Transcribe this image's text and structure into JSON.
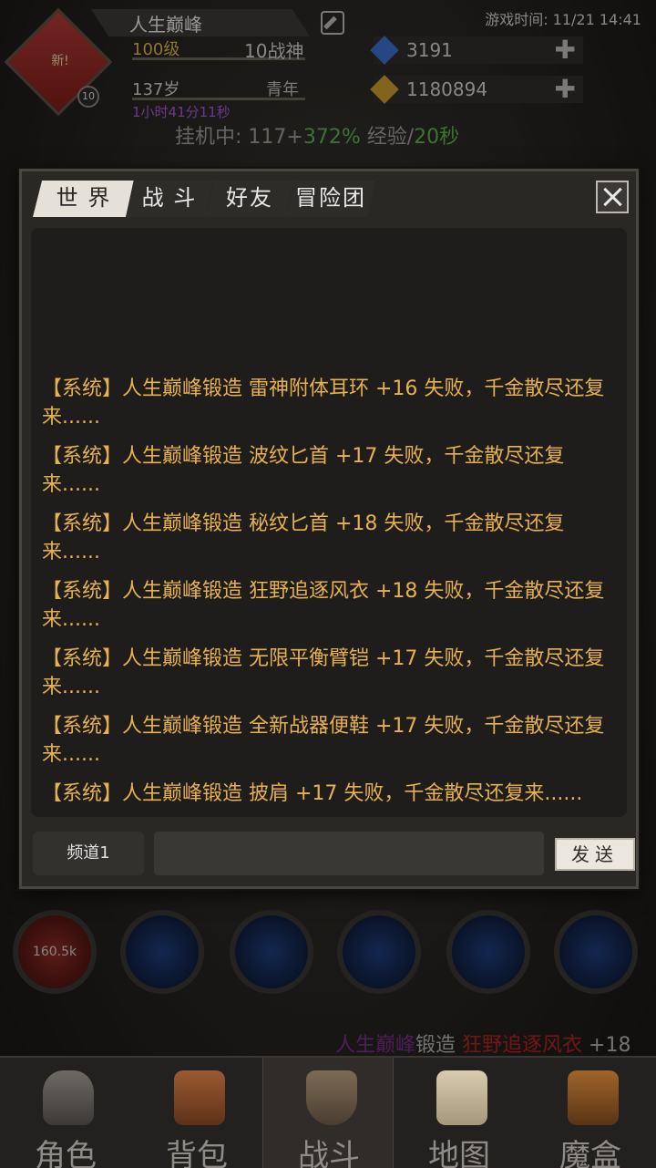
{
  "status": {
    "game_time": "游戏时间: 11/21 14:41"
  },
  "player": {
    "name": "人生巅峰",
    "avatar_badge": "新!",
    "badge_level": "10",
    "level": "100级",
    "title": "10战神",
    "age": "137岁",
    "life_stage": "青年",
    "timer": "1小时41分11秒",
    "idle_prefix": "挂机中: 117+",
    "idle_green1": "372%",
    "idle_mid": " 经验/",
    "idle_green2": "20秒"
  },
  "resources": [
    {
      "icon": "crystal-icon",
      "value": "3191",
      "color": "#3a6ec9"
    },
    {
      "icon": "gold-icon",
      "value": "1180894",
      "color": "#c99a2e"
    }
  ],
  "skills": {
    "hp_label": "160.5k",
    "items": [
      "health-orb-icon",
      "sword-skill-icon",
      "crescent-skill-icon",
      "rune-skill-icon",
      "splash-skill-icon",
      "wave-skill-icon"
    ]
  },
  "marquee": {
    "name": "人生巅峰",
    "mid": "锻造 ",
    "item": "狂野追逐风衣",
    "tail": " +18"
  },
  "chat": {
    "tabs": [
      "世 界",
      "战 斗",
      "好友",
      "冒险团"
    ],
    "active_tab": 0,
    "messages": [
      "【系统】人生巅峰锻造 雷神附体耳环 +16 失败，千金散尽还复来......",
      "【系统】人生巅峰锻造 波纹匕首 +17 失败，千金散尽还复来......",
      "【系统】人生巅峰锻造 秘纹匕首 +18 失败，千金散尽还复来......",
      "【系统】人生巅峰锻造 狂野追逐风衣 +18 失败，千金散尽还复来......",
      "【系统】人生巅峰锻造 无限平衡臂铠 +17 失败，千金散尽还复来......",
      "【系统】人生巅峰锻造 全新战器便鞋 +17 失败，千金散尽还复来......",
      "【系统】人生巅峰锻造 披肩 +17 失败，千金散尽还复来......"
    ],
    "channel_label": "频道1",
    "input_value": "",
    "input_placeholder": "",
    "send_label": "发送"
  },
  "bottom_nav": [
    {
      "label": "角色",
      "icon": "helmet-icon"
    },
    {
      "label": "背包",
      "icon": "backpack-icon"
    },
    {
      "label": "战斗",
      "icon": "sword-shield-icon"
    },
    {
      "label": "地图",
      "icon": "scroll-map-icon"
    },
    {
      "label": "魔盒",
      "icon": "magic-box-icon"
    }
  ],
  "active_nav": 2
}
